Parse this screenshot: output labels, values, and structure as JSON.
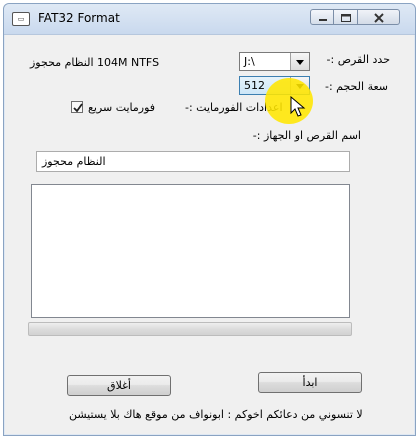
{
  "window": {
    "title": "FAT32 Format",
    "icon": "app-drive-icon",
    "controls": [
      "minimize-icon",
      "maximize-icon",
      "close-icon"
    ]
  },
  "drive": {
    "label": "حدد القرص :-",
    "value": "J:\\",
    "info": "104M NTFS النظام محجوز"
  },
  "cluster_size": {
    "label": "سعة الحجم :-",
    "value": "512"
  },
  "format_options": {
    "label": "اعدادات الفورمايت :-",
    "quick_format_label": "فورمايت سريع",
    "quick_format_checked": true
  },
  "volume": {
    "label": "اسم القرص او الجهاز :-",
    "value": "النظام محجوز"
  },
  "log": {
    "lines": []
  },
  "progress": {
    "fraction": 0
  },
  "buttons": {
    "start": "ابدأ",
    "close": "أغلاق"
  },
  "footer": "لا تنسوني من دعائكم اخوكم : ابونواف من موقع هاك بلا يستيشن",
  "colors": {
    "highlight": "#ffe600",
    "title_bar": "#c9d9ee"
  }
}
